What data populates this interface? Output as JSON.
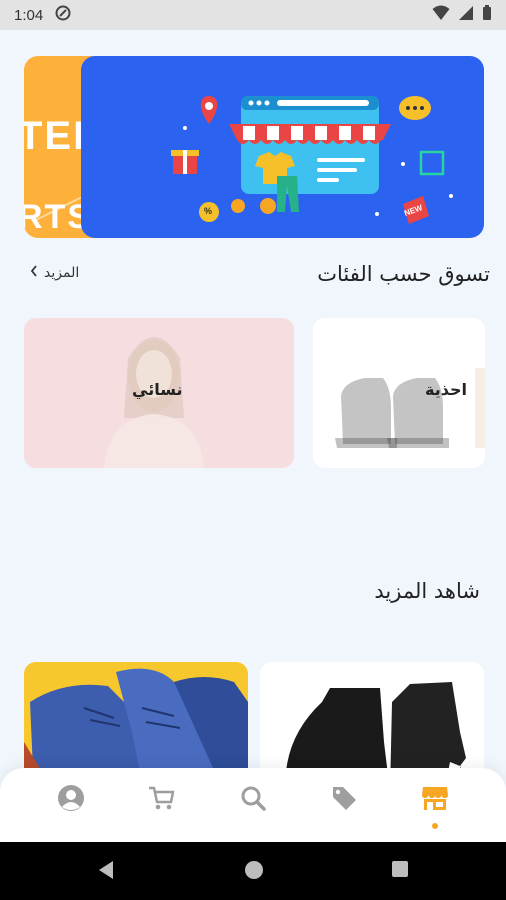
{
  "status_bar": {
    "time": "1:04"
  },
  "banner": {
    "side_text_1": "TER",
    "side_text_2": "RTS",
    "promo_tag": "NEW",
    "percent_badge": "%"
  },
  "categories_section": {
    "title": "تسوق حسب الفئات",
    "more_label": "المزيد",
    "items": [
      {
        "label": "نسائي"
      },
      {
        "label": "احذية"
      }
    ]
  },
  "see_more_section": {
    "title": "شاهد المزيد"
  },
  "bottom_nav": {
    "items": [
      "profile-icon",
      "cart-icon",
      "search-icon",
      "tag-icon",
      "store-icon"
    ],
    "active": "store-icon"
  },
  "colors": {
    "accent": "#f6a623",
    "banner_blue": "#2b62f0",
    "banner_orange": "#fdb13a",
    "background": "#f1f6fd"
  }
}
